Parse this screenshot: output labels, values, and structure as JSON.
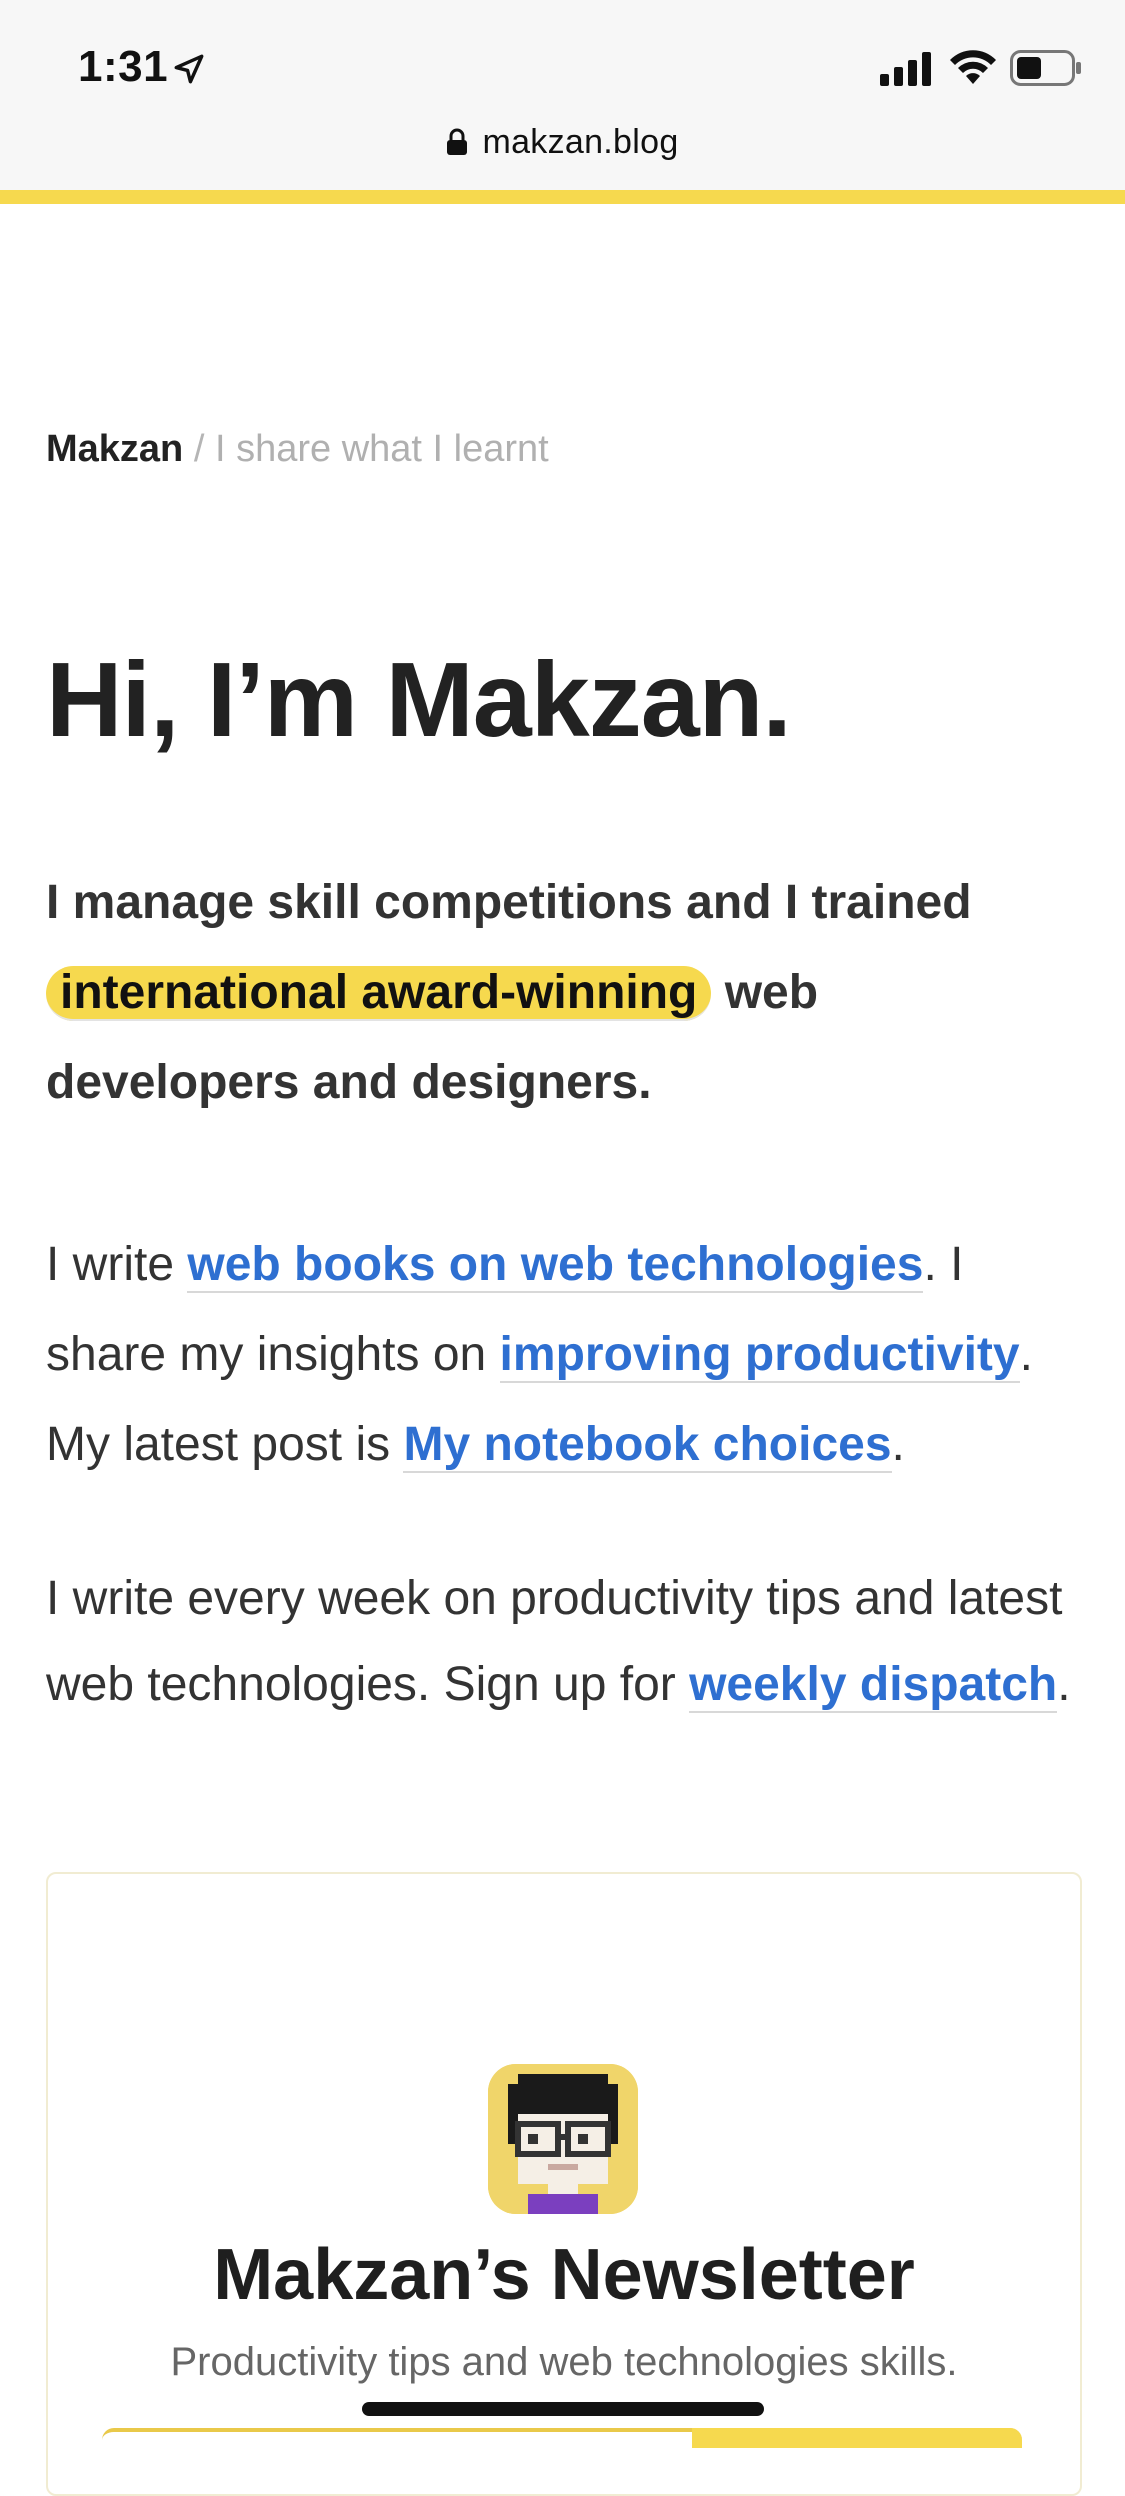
{
  "status_bar": {
    "time": "1:31",
    "icons": [
      "location-arrow-icon",
      "cellular-signal-icon",
      "wifi-icon",
      "battery-icon"
    ]
  },
  "browser": {
    "url": "makzan.blog",
    "lock_icon": "lock-icon"
  },
  "colors": {
    "accent_yellow": "#f6d94e",
    "link_blue": "#2e6fd1",
    "text_dark": "#222222",
    "muted": "#b0b0b0"
  },
  "header": {
    "brand": "Makzan",
    "separator": "/",
    "tagline": "I share what I learnt"
  },
  "hero": {
    "title": "Hi, I’m Makzan."
  },
  "intro": {
    "before": "I manage skill competitions and I trained ",
    "highlight": "international award-winning",
    "after": " web developers and designers."
  },
  "writing": {
    "t1": "I write ",
    "link1": "web books on web technologies",
    "t2": ". I share my insights on ",
    "link2": "improving productivity",
    "t3": ". My latest post is ",
    "link3": "My notebook choices",
    "t4": "."
  },
  "weekly": {
    "t1": "I write every week on productivity tips and latest web technologies. Sign up for ",
    "link": "weekly dispatch",
    "t2": "."
  },
  "newsletter": {
    "avatar_icon": "pixel-avatar-icon",
    "title": "Makzan’s Newsletter",
    "subtitle": "Productivity tips and web technologies skills."
  }
}
